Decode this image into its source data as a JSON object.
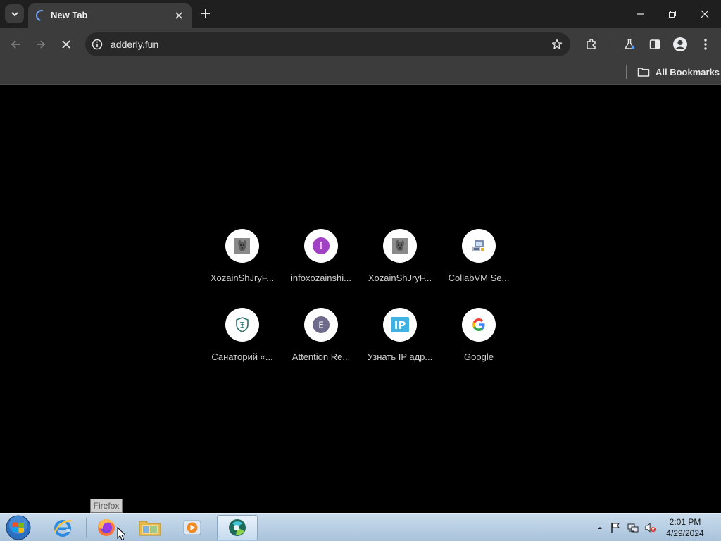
{
  "browser": {
    "tab": {
      "title": "New Tab"
    },
    "address_bar": {
      "url": "adderly.fun"
    },
    "bookmarks_bar": {
      "all_bookmarks_label": "All Bookmarks"
    }
  },
  "shortcuts": [
    {
      "label": "XozainShJryF...",
      "icon": "grey-dog-favicon"
    },
    {
      "label": "infoxozainshi...",
      "icon": "letter-I",
      "letter": "I",
      "color": "#a142c4"
    },
    {
      "label": "XozainShJryF...",
      "icon": "grey-dog-favicon"
    },
    {
      "label": "CollabVM Se...",
      "icon": "collabvm-favicon"
    },
    {
      "label": "Санаторий «...",
      "icon": "sanatorium-shield-favicon"
    },
    {
      "label": "Attention Re...",
      "icon": "letter-E",
      "letter": "E",
      "color": "#6e6a8c"
    },
    {
      "label": "Узнать IP адр...",
      "icon": "ip-favicon",
      "letter": "IP",
      "color": "#3fb1e3"
    },
    {
      "label": "Google",
      "icon": "google-g"
    }
  ],
  "taskbar": {
    "tooltip": "Firefox",
    "apps": [
      "start",
      "internet-explorer",
      "firefox",
      "file-explorer",
      "media-player",
      "chrome-app"
    ],
    "clock": {
      "time": "2:01 PM",
      "date": "4/29/2024"
    }
  },
  "colors": {
    "tab_strip": "#1f1f1f",
    "toolbar": "#3c3c3c",
    "omnibox": "#282828",
    "content_bg": "#000000"
  }
}
